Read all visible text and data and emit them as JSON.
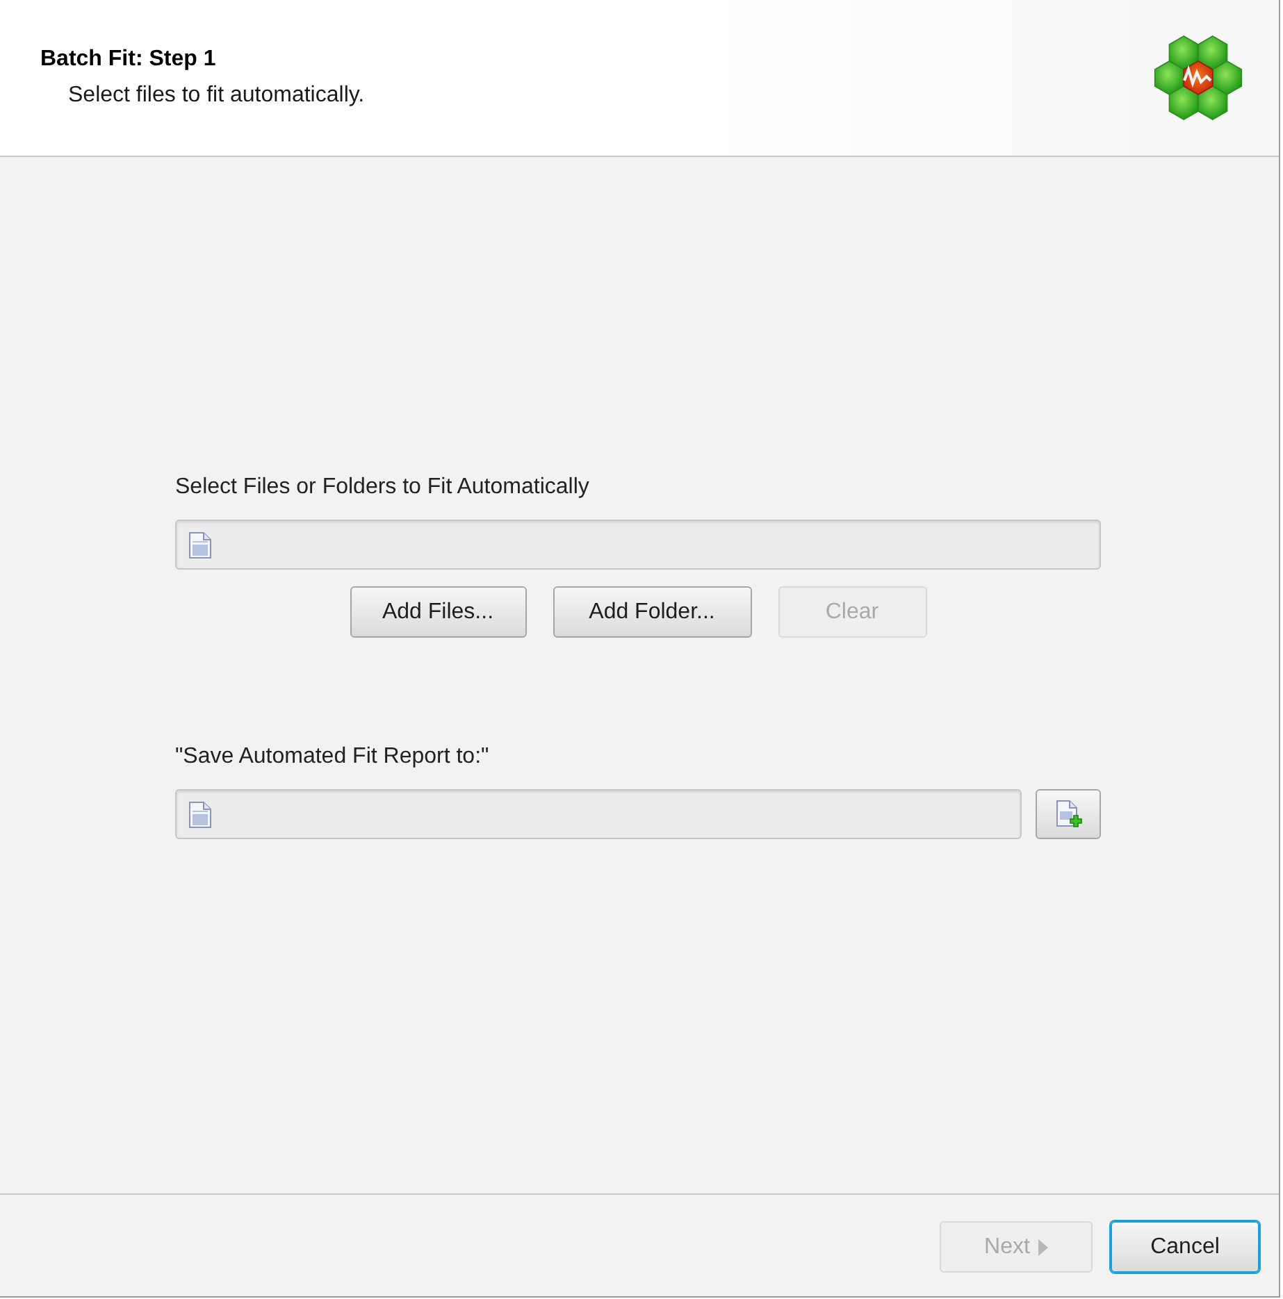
{
  "header": {
    "title": "Batch Fit: Step 1",
    "subtitle": "Select files to fit automatically."
  },
  "files_section": {
    "label": "Select Files or Folders to Fit Automatically",
    "buttons": [
      {
        "label": "Add Files...",
        "disabled": false
      },
      {
        "label": "Add Folder...",
        "disabled": false
      },
      {
        "label": "Clear",
        "disabled": true
      }
    ]
  },
  "report_section": {
    "label": "\"Save Automated Fit Report to:\""
  },
  "footer": {
    "buttons": [
      {
        "kind": "next",
        "label": "Next",
        "disabled": true,
        "focused": false
      },
      {
        "kind": "plain",
        "label": "Cancel",
        "disabled": false,
        "focused": true
      }
    ]
  }
}
